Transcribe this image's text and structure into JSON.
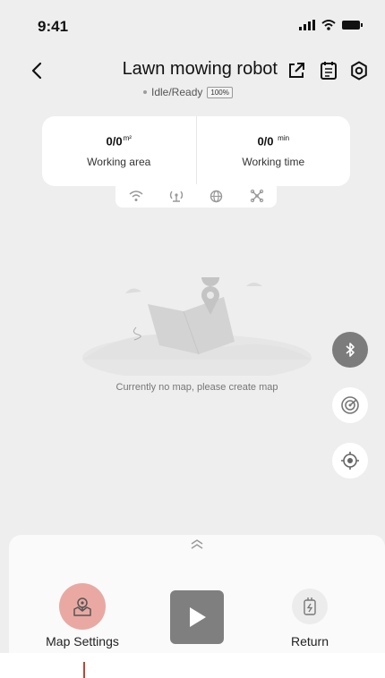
{
  "status_bar": {
    "time": "9:41"
  },
  "header": {
    "title": "Lawn mowing robot",
    "status": "Idle/Ready",
    "battery": "100%"
  },
  "stats": {
    "area": {
      "value": "0/0",
      "unit": "m²",
      "label": "Working area"
    },
    "time": {
      "value": "0/0",
      "unit": "min",
      "label": "Working time"
    }
  },
  "connectivity_icons": [
    "wifi-icon",
    "antenna-icon",
    "globe-icon",
    "propeller-icon"
  ],
  "map": {
    "empty_message": "Currently no map, please create map"
  },
  "side_buttons": [
    "bluetooth-icon",
    "radar-icon",
    "locate-icon"
  ],
  "bottom": {
    "map_settings_label": "Map Settings",
    "return_label": "Return"
  },
  "colors": {
    "background": "#eeeeee",
    "accent": "#e9a9a2",
    "play": "#7f7f7f",
    "pointer": "#c0442f"
  }
}
